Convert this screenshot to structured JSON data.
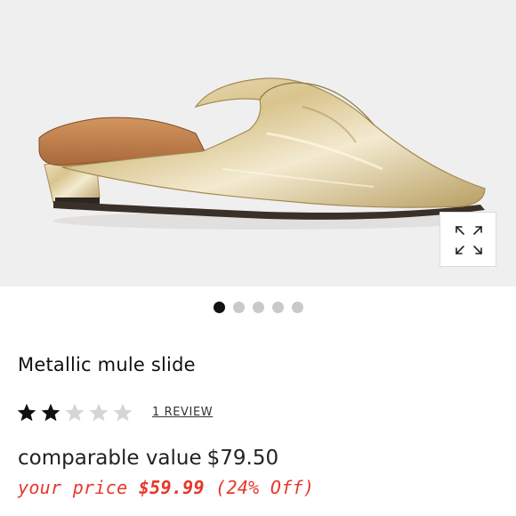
{
  "product": {
    "image_alt": "Gold metallic pointed-toe mule slide",
    "title": "Metallic mule slide"
  },
  "gallery": {
    "dot_count": 5,
    "active_index": 0
  },
  "rating": {
    "stars_filled": 2,
    "stars_total": 5,
    "review_link": "1 REVIEW"
  },
  "pricing": {
    "comparable_label": "comparable value",
    "comparable_value": "$79.50",
    "your_price_label": "your price",
    "your_price_value": "$59.99",
    "discount": "(24% Off)"
  },
  "colors": {
    "sale_red": "#e8362c",
    "active_dot": "#111111",
    "inactive_dot": "#c9c9c9",
    "hero_bg": "#f0efef",
    "star_empty": "#d5d5d5",
    "star_filled": "#111111"
  },
  "icons": {
    "expand": "expand-arrows-icon",
    "star": "star-icon"
  }
}
